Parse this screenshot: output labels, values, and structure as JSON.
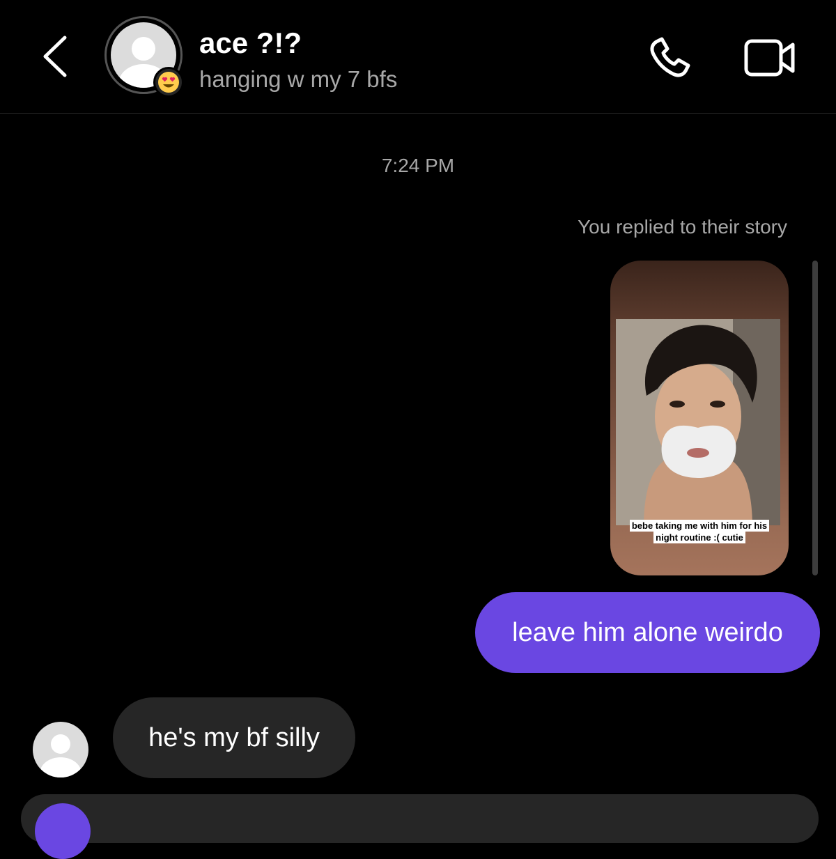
{
  "header": {
    "back_icon": "chevron-left-icon",
    "contact_name": "ace ?!?",
    "contact_status": "hanging w my 7 bfs",
    "status_emoji": "heart-eyes-emoji",
    "call_icon": "phone-icon",
    "video_icon": "video-camera-icon"
  },
  "thread": {
    "timestamp": "7:24 PM",
    "story_reply_note": "You replied to their story",
    "story": {
      "caption_line1": "bebe taking me with him for his",
      "caption_line2": "night routine :( cutie"
    },
    "messages": [
      {
        "sender": "me",
        "text": "leave him alone weirdo"
      },
      {
        "sender": "them",
        "text": "he's my bf silly"
      }
    ]
  },
  "colors": {
    "background": "#000000",
    "outgoing_bubble": "#6a47e2",
    "incoming_bubble": "#262626",
    "secondary_text": "#a8a8a8"
  }
}
